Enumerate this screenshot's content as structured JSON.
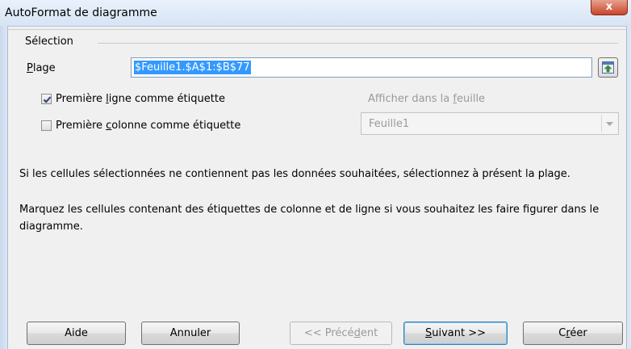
{
  "window": {
    "title": "AutoFormat de diagramme",
    "close_glyph": "x"
  },
  "selection": {
    "group_label": "Sélection",
    "range_label_accel": "P",
    "range_label_rest": "lage",
    "range_value": "$Feuille1.$A$1:$B$77",
    "shrink_button_icon": "shrink-dialog-icon",
    "first_row_checked": true,
    "first_row_pre": "Première ",
    "first_row_accel": "l",
    "first_row_post": "igne comme étiquette",
    "first_col_checked": false,
    "first_col_pre": "Première ",
    "first_col_accel": "c",
    "first_col_post": "olonne comme étiquette",
    "sheet_label_pre": "Afficher dans la ",
    "sheet_label_accel": "f",
    "sheet_label_post": "euille",
    "sheet_value": "Feuille1"
  },
  "info": {
    "para1": "Si les cellules sélectionnées ne contiennent pas les données souhaitées, sélectionnez à présent la plage.",
    "para2": "Marquez les cellules contenant des étiquettes de colonne et de ligne si vous souhaitez les faire figurer dans le diagramme."
  },
  "buttons": {
    "help": "Aide",
    "cancel": "Annuler",
    "prev_pre": "<< Précé",
    "prev_accel": "d",
    "prev_post": "ent",
    "next_accel": "S",
    "next_rest": "uivant >>",
    "finish_pre": "C",
    "finish_accel": "r",
    "finish_post": "éer"
  },
  "colors": {
    "selection_highlight": "#3399ff",
    "close_button": "#c8452c",
    "default_button_border": "#3c7fb1"
  }
}
